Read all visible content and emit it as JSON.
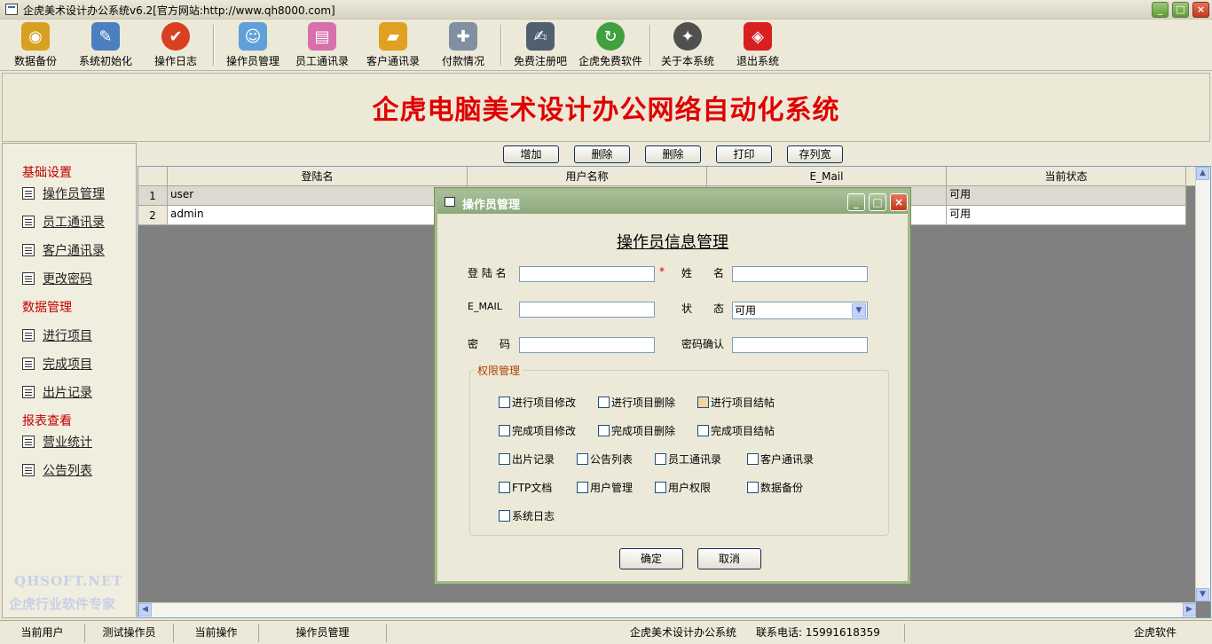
{
  "window": {
    "title": "企虎美术设计办公系统v6.2[官方网站:http://www.qh8000.com]"
  },
  "toolbar": [
    {
      "label": "数据备份",
      "icon": "database-icon",
      "color": "#d8a020"
    },
    {
      "label": "系统初始化",
      "icon": "pencil-paper-icon",
      "color": "#4a7fc0"
    },
    {
      "label": "操作日志",
      "icon": "checkmark-circle-icon",
      "color": "#d84020"
    },
    {
      "label": "操作员管理",
      "icon": "users-icon",
      "color": "#60a0d8"
    },
    {
      "label": "员工通讯录",
      "icon": "contact-card-icon",
      "color": "#d870b0"
    },
    {
      "label": "客户通讯录",
      "icon": "folder-book-icon",
      "color": "#e0a020"
    },
    {
      "label": "付款情况",
      "icon": "database-add-icon",
      "color": "#8090a0"
    },
    {
      "label": "免费注册吧",
      "icon": "register-icon",
      "color": "#506070"
    },
    {
      "label": "企虎免费软件",
      "icon": "refresh-icon",
      "color": "#40a040"
    },
    {
      "label": "关于本系统",
      "icon": "mascot-icon",
      "color": "#505050"
    },
    {
      "label": "退出系统",
      "icon": "exit-cube-icon",
      "color": "#d82020"
    }
  ],
  "banner": {
    "title": "企虎电脑美术设计办公网络自动化系统"
  },
  "sidebar": {
    "sections": [
      {
        "title": "基础设置",
        "items": [
          "操作员管理",
          "员工通讯录",
          "客户通讯录",
          "更改密码"
        ]
      },
      {
        "title": "数据管理",
        "items": [
          "进行项目",
          "完成项目",
          "出片记录"
        ]
      },
      {
        "title": "报表查看",
        "items": [
          "营业统计",
          "公告列表"
        ]
      }
    ],
    "watermark": [
      "QHSOFT.NET",
      "企虎行业软件专家"
    ]
  },
  "grid_toolbar": [
    "增加",
    "删除",
    "删除",
    "打印",
    "存列宽"
  ],
  "grid": {
    "columns": [
      "登陆名",
      "用户名称",
      "E_Mail",
      "当前状态"
    ],
    "rows": [
      {
        "num": "1",
        "login": "user",
        "name": "",
        "email": "",
        "status": "可用"
      },
      {
        "num": "2",
        "login": "admin",
        "name": "",
        "email": "",
        "status": "可用"
      }
    ]
  },
  "statusbar": [
    "当前用户",
    "测试操作员",
    "当前操作",
    "操作员管理",
    "企虎美术设计办公系统",
    "联系电话: 15991618359",
    "企虎软件"
  ],
  "dialog": {
    "title": "操作员管理",
    "heading": "操作员信息管理",
    "fields": {
      "login_label": "登 陆 名",
      "name_label": "姓　　名",
      "email_label": "E_MAIL",
      "status_label": "状　　态",
      "status_value": "可用",
      "password_label": "密　　码",
      "confirm_label": "密码确认",
      "login_value": "",
      "name_value": "",
      "email_value": "",
      "password_value": "",
      "confirm_value": ""
    },
    "required_mark": "*",
    "permissions_title": "权限管理",
    "permissions": [
      [
        "进行项目修改",
        "进行项目删除",
        "进行项目结帖"
      ],
      [
        "完成项目修改",
        "完成项目删除",
        "完成项目结帖"
      ],
      [
        "出片记录",
        "公告列表",
        "员工通讯录",
        "客户通讯录"
      ],
      [
        "FTP文档",
        "用户管理",
        "用户权限",
        "数据备份"
      ],
      [
        "系统日志"
      ]
    ],
    "ok_label": "确定",
    "cancel_label": "取消"
  }
}
